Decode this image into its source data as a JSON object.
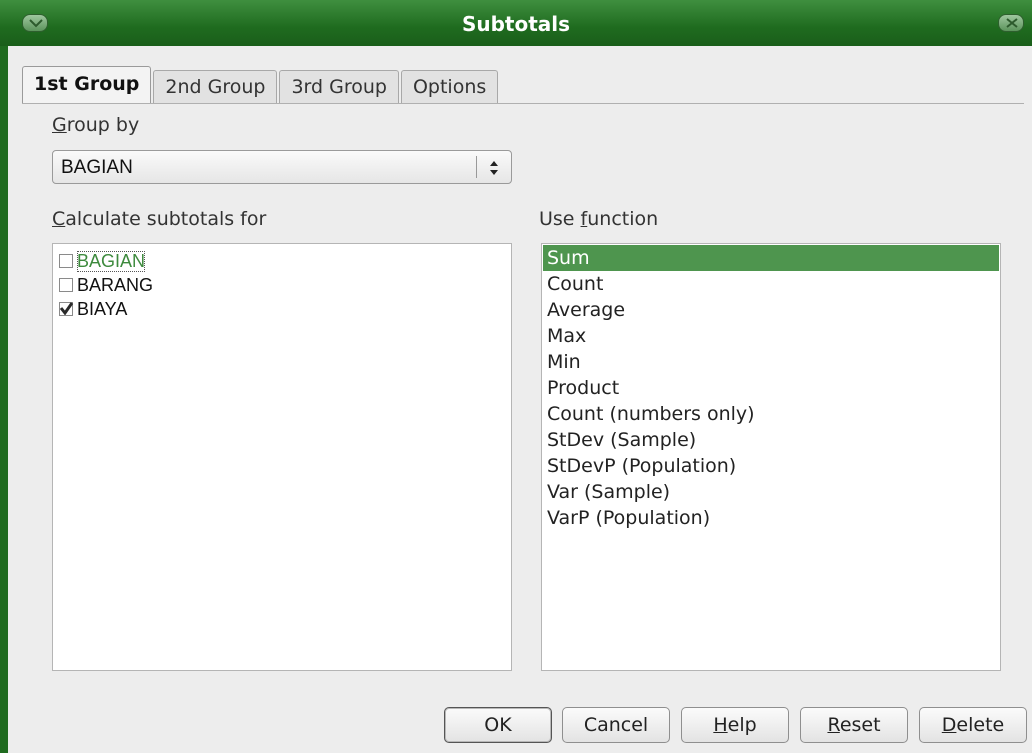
{
  "window": {
    "title": "Subtotals"
  },
  "tabs": [
    {
      "label": "1st Group",
      "active": true
    },
    {
      "label": "2nd Group",
      "active": false
    },
    {
      "label": "3rd Group",
      "active": false
    },
    {
      "label": "Options",
      "active": false
    }
  ],
  "group_by": {
    "label": "Group by",
    "mnemonic": "G",
    "selected": "BAGIAN"
  },
  "subtotals_for": {
    "label": "Calculate subtotals for",
    "mnemonic": "C",
    "items": [
      {
        "label": "BAGIAN",
        "checked": false,
        "focused": true
      },
      {
        "label": "BARANG",
        "checked": false,
        "focused": false
      },
      {
        "label": "BIAYA",
        "checked": true,
        "focused": false
      }
    ]
  },
  "use_function": {
    "label": "Use function",
    "mnemonic": "f",
    "items": [
      {
        "label": "Sum",
        "selected": true
      },
      {
        "label": "Count",
        "selected": false
      },
      {
        "label": "Average",
        "selected": false
      },
      {
        "label": "Max",
        "selected": false
      },
      {
        "label": "Min",
        "selected": false
      },
      {
        "label": "Product",
        "selected": false
      },
      {
        "label": "Count (numbers only)",
        "selected": false
      },
      {
        "label": "StDev (Sample)",
        "selected": false
      },
      {
        "label": "StDevP (Population)",
        "selected": false
      },
      {
        "label": "Var (Sample)",
        "selected": false
      },
      {
        "label": "VarP (Population)",
        "selected": false
      }
    ]
  },
  "buttons": {
    "ok": "OK",
    "cancel": "Cancel",
    "help": "Help",
    "reset": "Reset",
    "delete": "Delete"
  },
  "colors": {
    "window_frame": "#1f6b1f",
    "selection": "#4e954e",
    "dialog_bg": "#ededed"
  }
}
